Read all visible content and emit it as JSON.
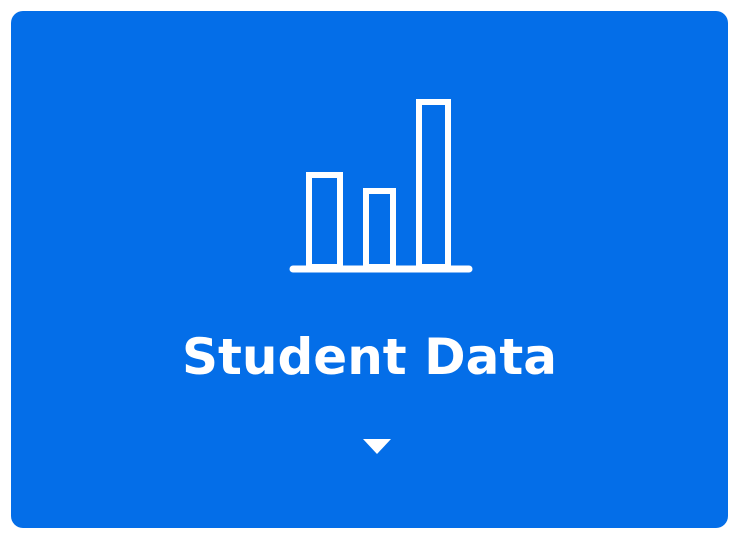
{
  "tile": {
    "label": "Student Data",
    "icon": "bar-chart-icon",
    "expand_icon": "caret-down-icon",
    "colors": {
      "background": "#046ee8",
      "foreground": "#ffffff"
    }
  }
}
